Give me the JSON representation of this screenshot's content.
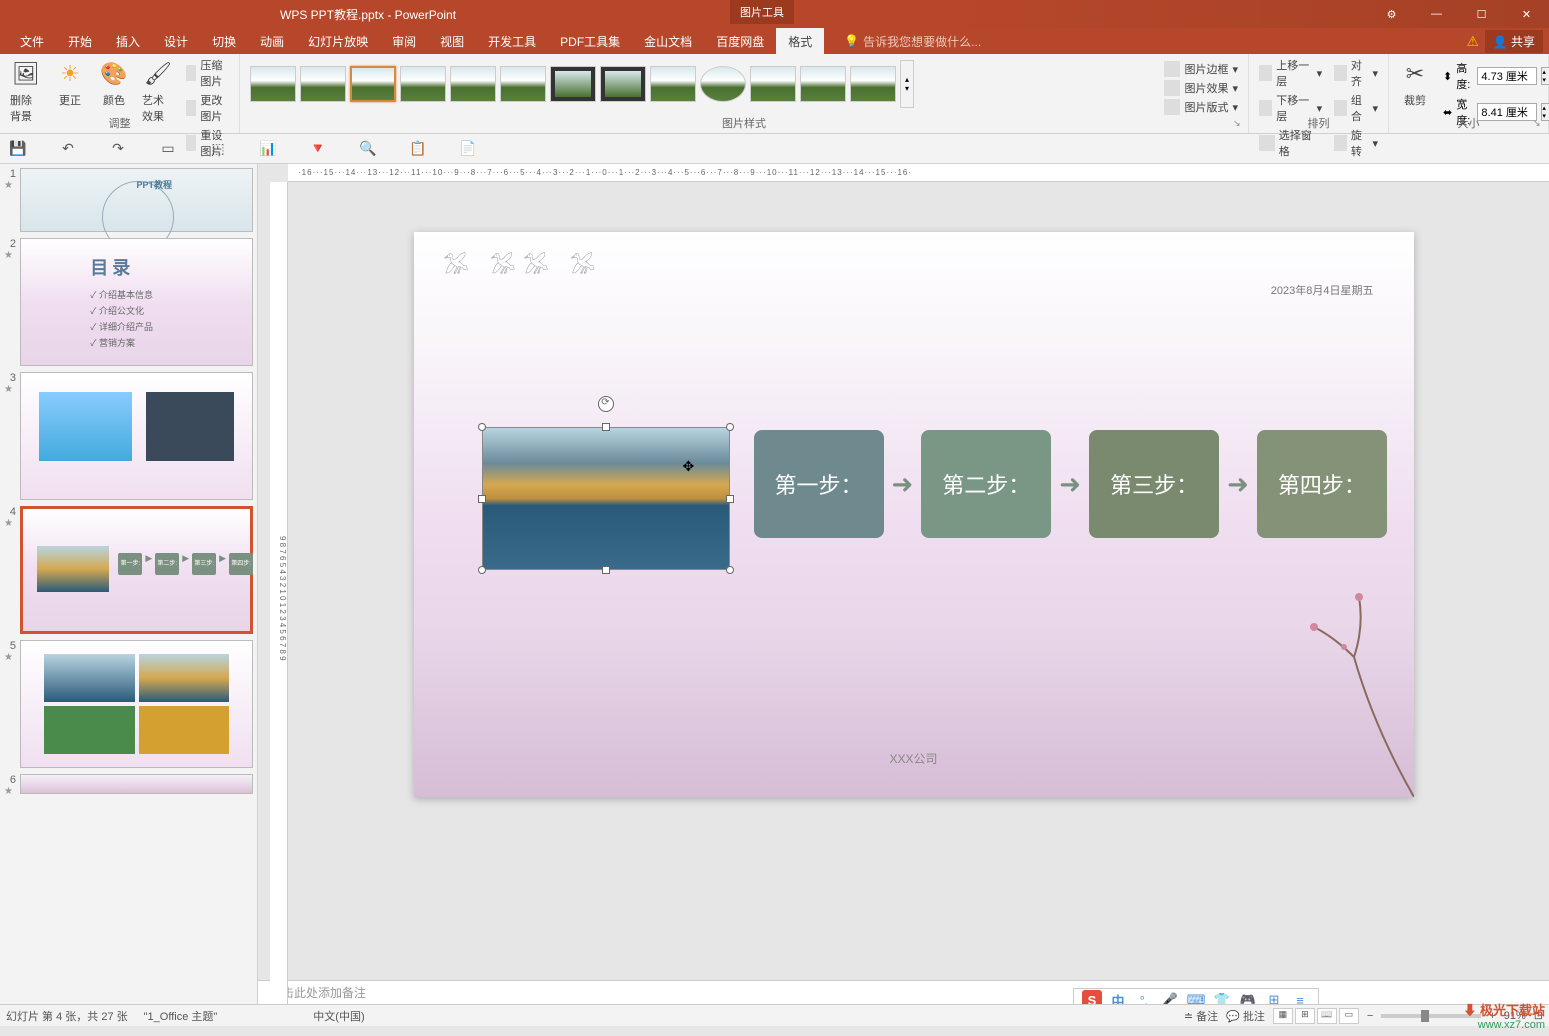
{
  "titlebar": {
    "title": "WPS PPT教程.pptx - PowerPoint",
    "context_tab": "图片工具"
  },
  "window": {
    "min": "—",
    "max": "☐",
    "close": "✕",
    "opts": "⚙"
  },
  "menu": {
    "file": "文件",
    "home": "开始",
    "insert": "插入",
    "design": "设计",
    "transition": "切换",
    "anim": "动画",
    "slideshow": "幻灯片放映",
    "review": "审阅",
    "view": "视图",
    "dev": "开发工具",
    "pdf": "PDF工具集",
    "wpsdoc": "金山文档",
    "baidu": "百度网盘",
    "format": "格式",
    "tellme": "告诉我您想要做什么...",
    "share": "共享"
  },
  "ribbon": {
    "adjust": {
      "label": "调整",
      "remove_bg": "删除背景",
      "correct": "更正",
      "color": "颜色",
      "effects": "艺术效果",
      "compress": "压缩图片",
      "change": "更改图片",
      "reset": "重设图片"
    },
    "styles": {
      "label": "图片样式",
      "border": "图片边框",
      "fx": "图片效果",
      "layout": "图片版式"
    },
    "arrange": {
      "label": "排列",
      "forward": "上移一层",
      "backward": "下移一层",
      "pane": "选择窗格",
      "align": "对齐",
      "group": "组合",
      "rotate": "旋转"
    },
    "size": {
      "label": "大小",
      "crop": "裁剪",
      "height_lbl": "高度:",
      "height_val": "4.73 厘米",
      "width_lbl": "宽度:",
      "width_val": "8.41 厘米"
    }
  },
  "ruler_marks": "·16···15···14···13···12···11···10···9···8···7···6···5···4···3···2···1···0···1···2···3···4···5···6···7···8···9···10···11···12···13···14···15···16·",
  "slide": {
    "date": "2023年8月4日星期五",
    "company": "XXX公司",
    "steps": [
      "第一步：",
      "第二步：",
      "第三步：",
      "第四步："
    ]
  },
  "thumbs": {
    "t2_title": "目录",
    "t2_items": [
      "✓ 介绍基本信息",
      "✓ 介绍公文化",
      "✓ 详细介绍产品",
      "✓ 营销方案"
    ],
    "t4_steps": [
      "第一步:",
      "第二步:",
      "第三步:",
      "第四步:"
    ]
  },
  "notes": "单击此处添加备注",
  "status": {
    "slide": "幻灯片 第 4 张，共 27 张",
    "theme": "\"1_Office 主题\"",
    "lang": "中文(中国)",
    "notes_btn": "备注",
    "comments": "批注",
    "zoom": "91%"
  },
  "ime": {
    "s": "S",
    "zh": "中",
    "mic": "🎤",
    "upload": "⬆",
    "shirt": "👕",
    "game": "🎮",
    "grid": "⚙",
    "more": "⋮"
  },
  "watermark": {
    "l1": "⬇ 极光下载站",
    "l2": "www.xz7.com"
  }
}
